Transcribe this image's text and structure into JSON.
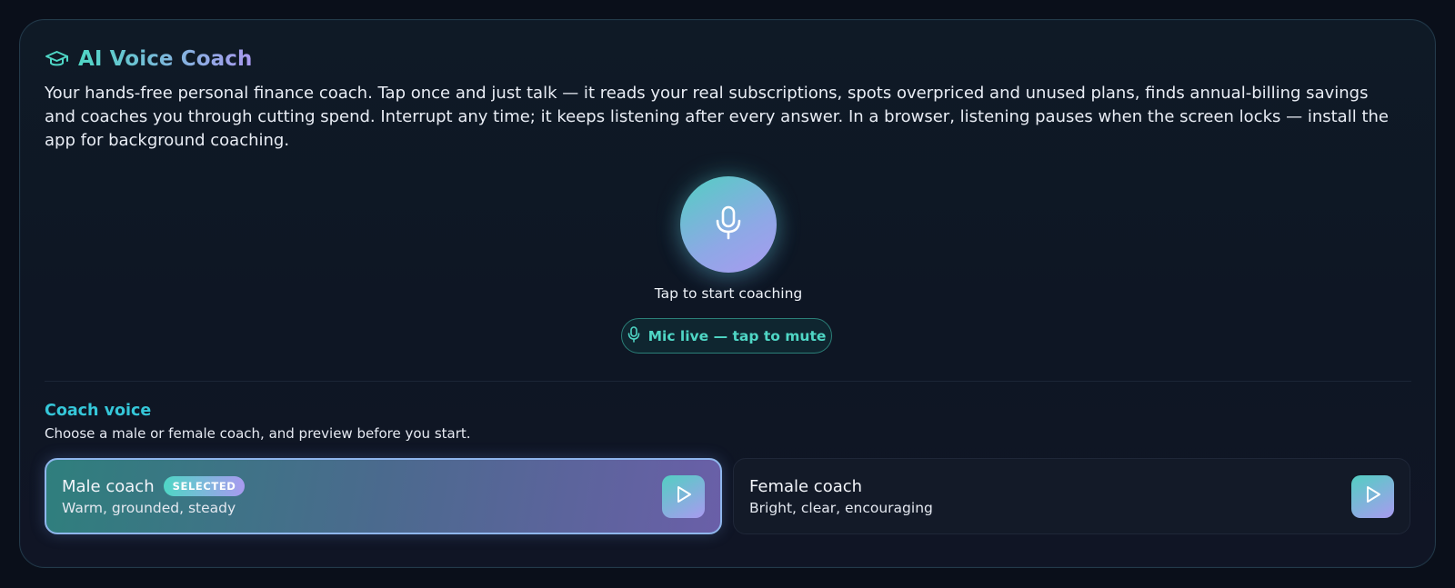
{
  "header": {
    "title": "AI Voice Coach",
    "description": "Your hands-free personal finance coach. Tap once and just talk — it reads your real subscriptions, spots overpriced and unused plans, finds annual-billing savings and coaches you through cutting spend. Interrupt any time; it keeps listening after every answer. In a browser, listening pauses when the screen locks — install the app for background coaching.",
    "icon": "graduation-cap-icon"
  },
  "mic": {
    "icon": "microphone-icon",
    "tap_label": "Tap to start coaching",
    "mute_label": "Mic live — tap to mute"
  },
  "voice": {
    "title": "Coach voice",
    "subtitle": "Choose a male or female coach, and preview before you start.",
    "options": [
      {
        "name": "Male coach",
        "description": "Warm, grounded, steady",
        "badge": "SELECTED",
        "selected": true
      },
      {
        "name": "Female coach",
        "description": "Bright, clear, encouraging",
        "selected": false
      }
    ],
    "preview_icon": "play-icon"
  },
  "colors": {
    "accent_teal": "#4fd6c5",
    "accent_purple": "#a99af0",
    "section_heading": "#35c6d8",
    "background": "#0a0f1a"
  }
}
